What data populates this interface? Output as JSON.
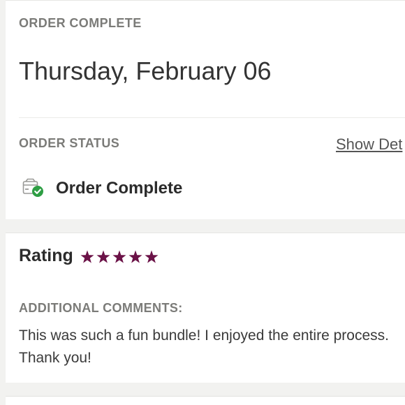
{
  "order": {
    "section_label": "ORDER COMPLETE",
    "date": "Thursday, February 06"
  },
  "status": {
    "section_label": "ORDER STATUS",
    "show_details_label": "Show Det",
    "status_icon": "package-check-icon",
    "status_text": "Order Complete"
  },
  "rating": {
    "label": "Rating",
    "stars": 5,
    "max_stars": 5,
    "star_icon": "star-icon",
    "star_color": "#6b1247"
  },
  "comments": {
    "section_label": "ADDITIONAL COMMENTS:",
    "text": "This was such a fun bundle! I enjoyed the entire process. Thank you!"
  },
  "colors": {
    "check_green": "#2e9e44",
    "label_gray": "#7b7b78",
    "text_dark": "#2b2b2b"
  }
}
